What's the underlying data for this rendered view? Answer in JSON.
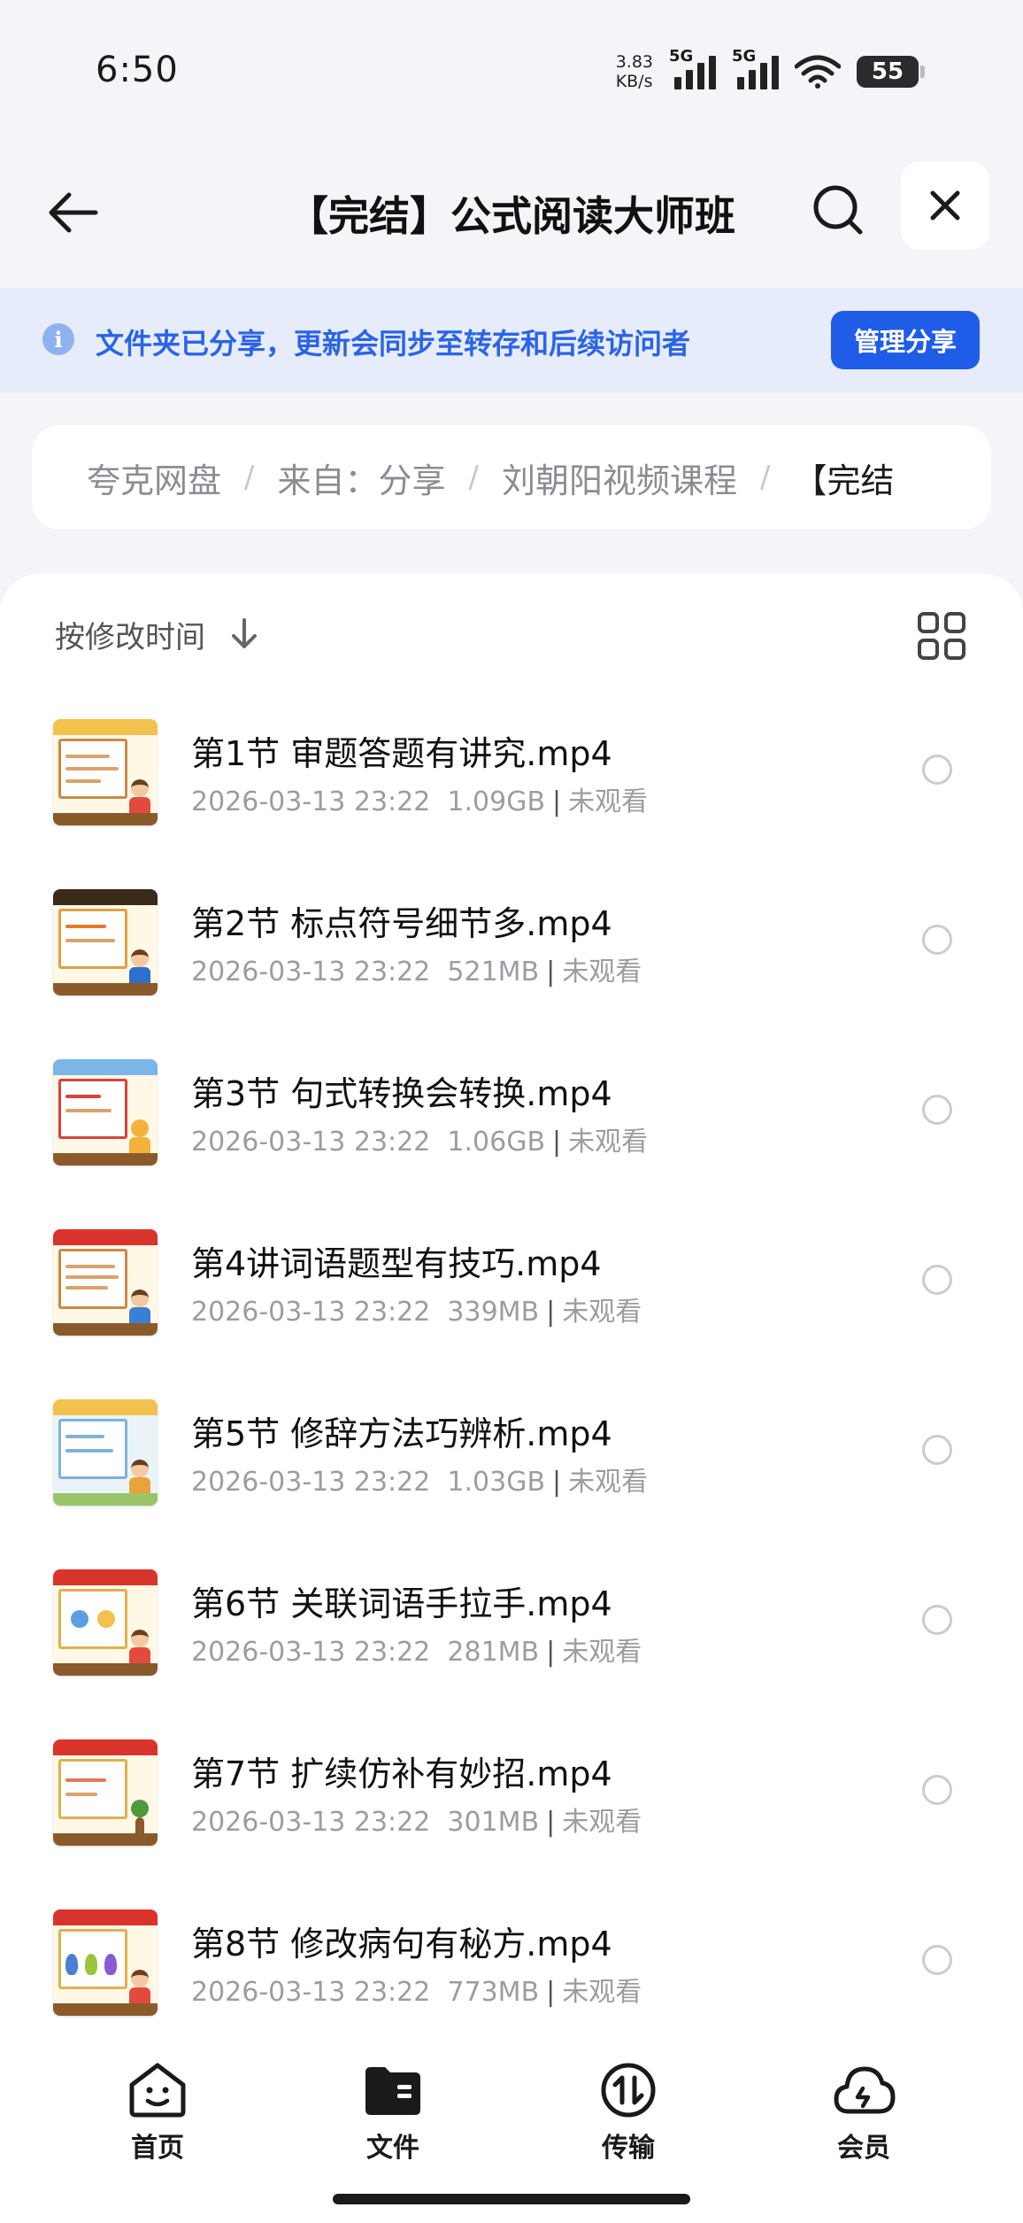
{
  "status_bar": {
    "time": "6:50",
    "net_speed_value": "3.83",
    "net_speed_unit": "KB/s",
    "signal1_label": "5G",
    "signal2_label": "5G",
    "wifi_label": "6",
    "battery": "55"
  },
  "header": {
    "title": "【完结】公式阅读大师班",
    "back_icon": "arrow-left-icon",
    "search_icon": "search-icon",
    "close_icon": "close-icon"
  },
  "share_banner": {
    "text": "文件夹已分享，更新会同步至转存和后续访问者",
    "button": "管理分享",
    "accent": "#1f5ce8"
  },
  "breadcrumb": {
    "items": [
      "夸克网盘",
      "来自：分享",
      "刘朝阳视频课程",
      "【完结"
    ],
    "separator": "/"
  },
  "sort": {
    "label": "按修改时间",
    "arrow_icon": "arrow-down-icon",
    "view_icon": "grid-view-icon"
  },
  "files": [
    {
      "name": "第1节 审题答题有讲究.mp4",
      "date": "2026-03-13 23:22",
      "size": "1.09GB",
      "status": "未观看"
    },
    {
      "name": "第2节 标点符号细节多.mp4",
      "date": "2026-03-13 23:22",
      "size": "521MB",
      "status": "未观看"
    },
    {
      "name": "第3节 句式转换会转换.mp4",
      "date": "2026-03-13 23:22",
      "size": "1.06GB",
      "status": "未观看"
    },
    {
      "name": "第4讲词语题型有技巧.mp4",
      "date": "2026-03-13 23:22",
      "size": "339MB",
      "status": "未观看"
    },
    {
      "name": "第5节 修辞方法巧辨析.mp4",
      "date": "2026-03-13 23:22",
      "size": "1.03GB",
      "status": "未观看"
    },
    {
      "name": "第6节 关联词语手拉手.mp4",
      "date": "2026-03-13 23:22",
      "size": "281MB",
      "status": "未观看"
    },
    {
      "name": "第7节 扩续仿补有妙招.mp4",
      "date": "2026-03-13 23:22",
      "size": "301MB",
      "status": "未观看"
    },
    {
      "name": "第8节 修改病句有秘方.mp4",
      "date": "2026-03-13 23:22",
      "size": "773MB",
      "status": "未观看"
    }
  ],
  "bottom_nav": [
    {
      "label": "首页",
      "icon": "home-smile-icon"
    },
    {
      "label": "文件",
      "icon": "folder-icon"
    },
    {
      "label": "传输",
      "icon": "transfer-icon"
    },
    {
      "label": "会员",
      "icon": "cloud-icon"
    }
  ]
}
